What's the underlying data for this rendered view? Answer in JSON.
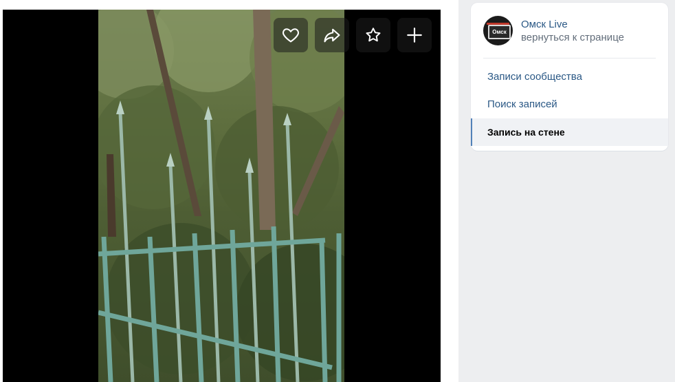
{
  "video": {
    "actions": [
      {
        "icon": "heart-icon",
        "label": "like"
      },
      {
        "icon": "share-icon",
        "label": "share"
      },
      {
        "icon": "star-icon",
        "label": "favorite"
      },
      {
        "icon": "plus-icon",
        "label": "add"
      }
    ]
  },
  "sidebar": {
    "group_name": "Омск Live",
    "group_sub": "вернуться к странице",
    "avatar_text": "Омск",
    "menu": [
      {
        "label": "Записи сообщества"
      },
      {
        "label": "Поиск записей"
      },
      {
        "label": "Запись на стене"
      }
    ]
  },
  "colors": {
    "link": "#2a5885",
    "accent": "#5181b8",
    "background": "#edeef0"
  }
}
